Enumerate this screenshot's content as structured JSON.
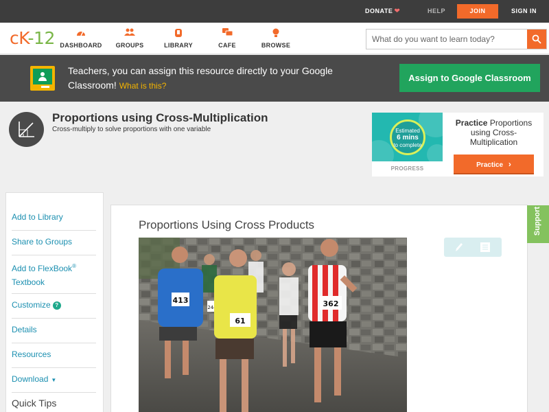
{
  "topbar": {
    "donate": "DONATE",
    "help": "HELP",
    "join": "JOIN",
    "signin": "SIGN IN"
  },
  "logo": {
    "c": "cK",
    "dash": "-",
    "num": "12"
  },
  "nav": {
    "items": [
      {
        "label": "DASHBOARD",
        "icon": "dashboard-icon"
      },
      {
        "label": "GROUPS",
        "icon": "groups-icon"
      },
      {
        "label": "LIBRARY",
        "icon": "library-icon"
      },
      {
        "label": "CAFE",
        "icon": "cafe-icon"
      },
      {
        "label": "BROWSE",
        "icon": "browse-icon"
      }
    ],
    "search_placeholder": "What do you want to learn today?"
  },
  "banner": {
    "text": "Teachers, you can assign this resource directly to your Google Classroom!",
    "what_link": "What is this?",
    "button": "Assign to Google Classroom"
  },
  "header": {
    "title": "Proportions using Cross-Multiplication",
    "subtitle": "Cross-multiply to solve proportions with one variable"
  },
  "practice": {
    "estimated": "Estimated",
    "mins": "6 mins",
    "complete": "to complete",
    "progress_label": "PROGRESS",
    "label_bold": "Practice",
    "label_rest": "Proportions using Cross-Multiplication",
    "button": "Practice"
  },
  "sidebar": {
    "add_library": "Add to Library",
    "share_groups": "Share to Groups",
    "add_flexbook": "Add to FlexBook",
    "reg": "®",
    "textbook": "Textbook",
    "customize": "Customize",
    "customize_help": "?",
    "details": "Details",
    "resources": "Resources",
    "download": "Download",
    "download_caret": "▼",
    "quick_tips": "Quick Tips"
  },
  "content": {
    "title": "Proportions Using Cross Products",
    "bibs": [
      "413",
      "244",
      "61",
      "362"
    ]
  },
  "support": "Support",
  "colors": {
    "accent": "#f26a2a",
    "link": "#1b8fb0",
    "green": "#21a45d",
    "support": "#84c25e"
  }
}
